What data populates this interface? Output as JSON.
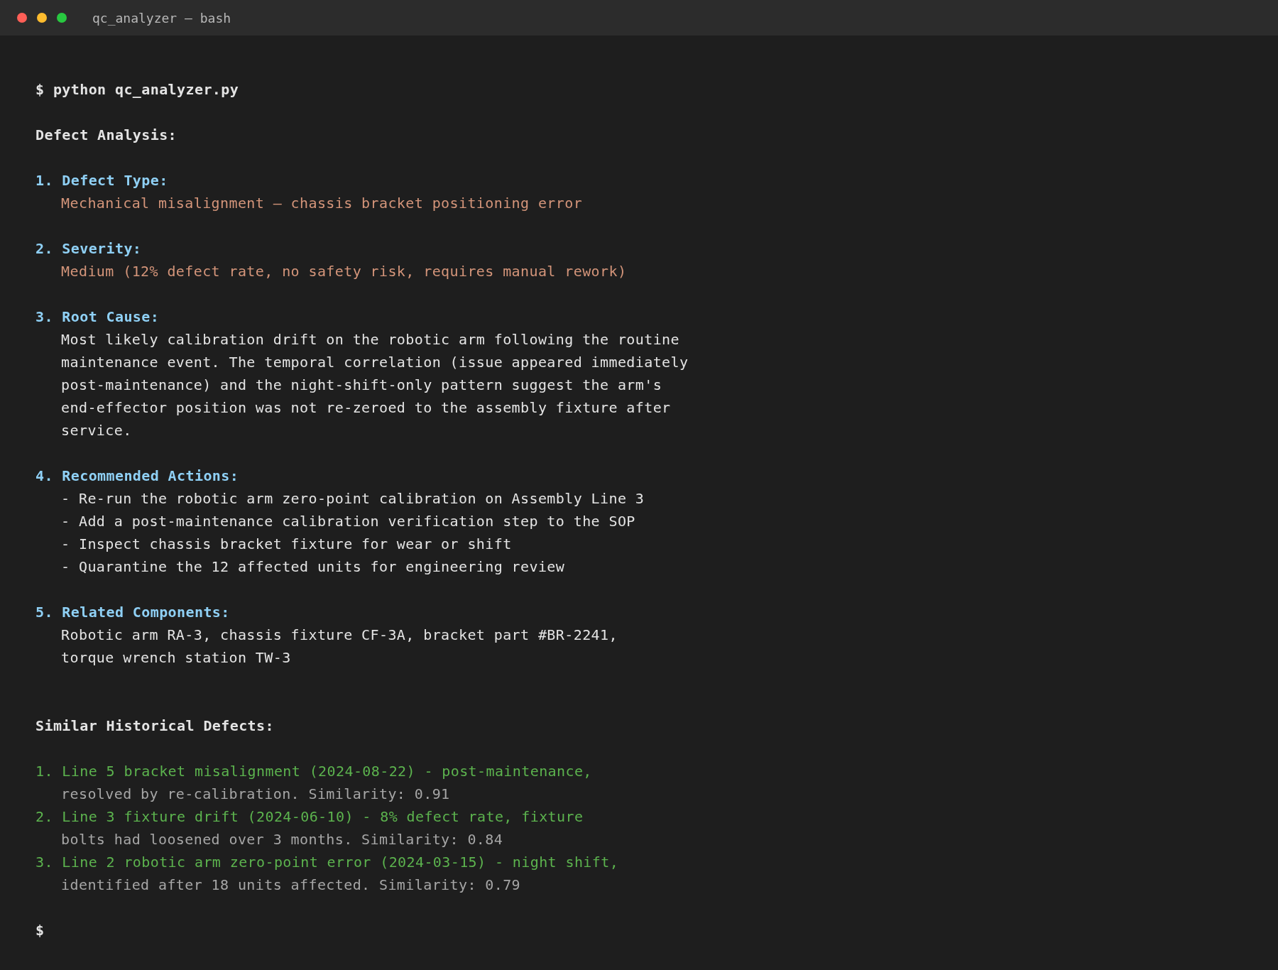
{
  "window": {
    "title": "qc_analyzer — bash"
  },
  "command": "$ python qc_analyzer.py",
  "heading": "Defect Analysis:",
  "sections": [
    {
      "number": "1.",
      "title": "Defect Type:",
      "kind": "highlight",
      "lines": [
        "Mechanical misalignment — chassis bracket positioning error"
      ]
    },
    {
      "number": "2.",
      "title": "Severity:",
      "kind": "highlight",
      "lines": [
        "Medium (12% defect rate, no safety risk, requires manual rework)"
      ]
    },
    {
      "number": "3.",
      "title": "Root Cause:",
      "kind": "plain",
      "lines": [
        "Most likely calibration drift on the robotic arm following the routine",
        "maintenance event. The temporal correlation (issue appeared immediately",
        "post-maintenance) and the night-shift-only pattern suggest the arm's",
        "end-effector position was not re-zeroed to the assembly fixture after",
        "service."
      ]
    },
    {
      "number": "4.",
      "title": "Recommended Actions:",
      "kind": "plain",
      "lines": [
        "- Re-run the robotic arm zero-point calibration on Assembly Line 3",
        "- Add a post-maintenance calibration verification step to the SOP",
        "- Inspect chassis bracket fixture for wear or shift",
        "- Quarantine the 12 affected units for engineering review"
      ]
    },
    {
      "number": "5.",
      "title": "Related Components:",
      "kind": "plain",
      "lines": [
        "Robotic arm RA-3, chassis fixture CF-3A, bracket part #BR-2241,",
        "torque wrench station TW-3"
      ]
    }
  ],
  "history_heading": "Similar Historical Defects:",
  "history": [
    {
      "number": "1.",
      "summary": "Line 5 bracket misalignment (2024-08-22) - post-maintenance,",
      "detail": "resolved by re-calibration. Similarity: 0.91"
    },
    {
      "number": "2.",
      "summary": "Line 3 fixture drift (2024-06-10) - 8% defect rate, fixture",
      "detail": "bolts had loosened over 3 months. Similarity: 0.84"
    },
    {
      "number": "3.",
      "summary": "Line 2 robotic arm zero-point error (2024-03-15) - night shift,",
      "detail": "identified after 18 units affected. Similarity: 0.79"
    }
  ],
  "final_prompt": "$"
}
